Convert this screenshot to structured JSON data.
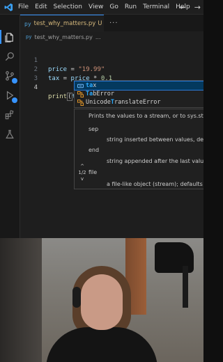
{
  "menu": [
    "File",
    "Edit",
    "Selection",
    "View",
    "Go",
    "Run",
    "Terminal",
    "Help"
  ],
  "nav": {
    "back": "←",
    "forward": "→"
  },
  "tab": {
    "lang": "py",
    "name": "test_why_matters.py",
    "modified": "U",
    "more": "..."
  },
  "breadcrumb": {
    "lang": "py",
    "file": "test_why_matters.py",
    "more": "..."
  },
  "code": {
    "line_numbers": [
      "1",
      "2",
      "3",
      "4"
    ],
    "line1": {
      "var": "price",
      "op": " = ",
      "str": "\"19.99\""
    },
    "line2": {
      "var": "tax",
      "op1": " = ",
      "var2": "price",
      "op2": " * ",
      "num": "0.1"
    },
    "line4": {
      "fn": "print",
      "open": "(",
      "typed": "ta",
      "close": ")"
    }
  },
  "suggestions": [
    {
      "kind": "variable",
      "match": "ta",
      "rest": "x",
      "full": "tax",
      "selected": true
    },
    {
      "kind": "class",
      "match": "Ta",
      "rest": "bError",
      "full": "TabError",
      "selected": false
    },
    {
      "kind": "class",
      "pre": "Unicode",
      "match": "T",
      "rest": "ranslateError",
      "full": "UnicodeTranslateError",
      "selected": false
    }
  ],
  "hint": {
    "summary": "Prints the values to a stream, or to sys.stdout",
    "p1_name": "sep",
    "p1_desc": "string inserted between values, default",
    "p2_name": "end",
    "p2_desc": "string appended after the last value, d",
    "p3_name": "file",
    "p3_desc": "a file-like object (stream); defaults to t",
    "nav_up": "^",
    "counter": "1/2",
    "nav_down": "v"
  },
  "colors": {
    "accent": "#3794ff",
    "editor_bg": "#1e1e1e",
    "selection": "#04395e"
  }
}
